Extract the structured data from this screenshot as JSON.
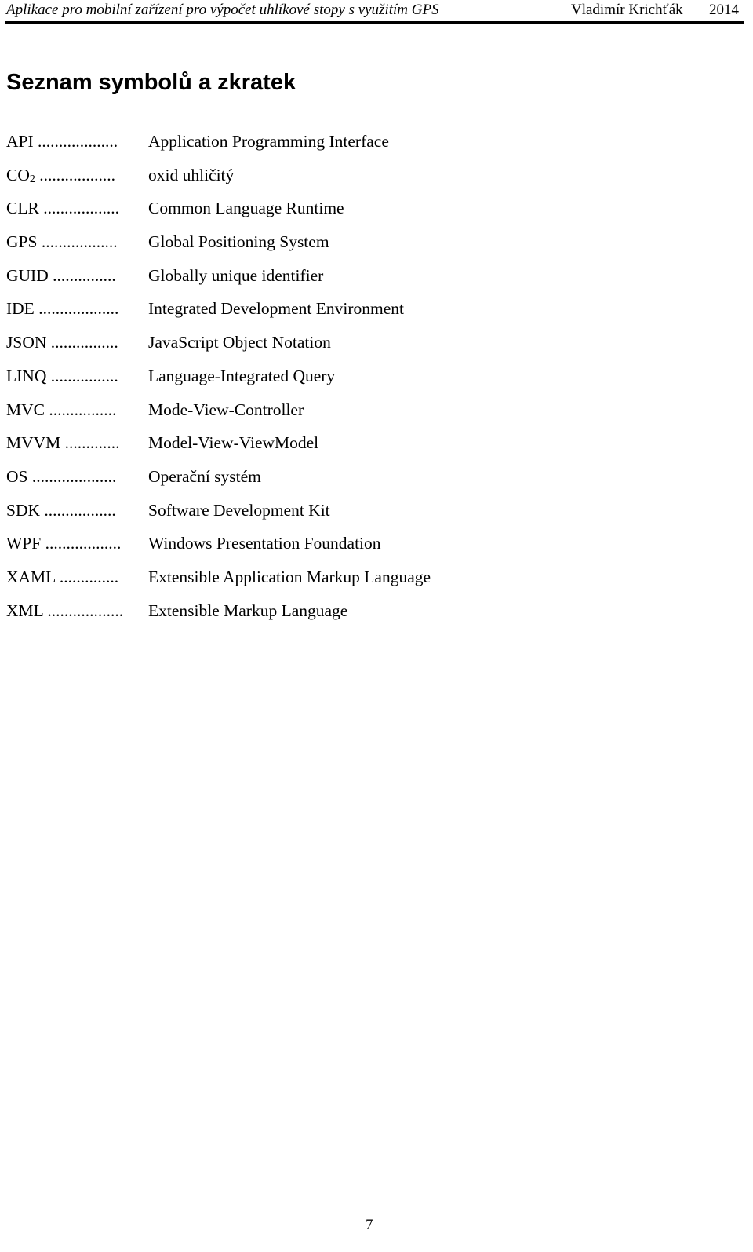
{
  "header": {
    "title": "Aplikace pro mobilní zařízení pro výpočet uhlíkové stopy s využitím GPS",
    "author": "Vladimír Krichťák",
    "year": "2014"
  },
  "heading": "Seznam symbolů a zkratek",
  "entries": [
    {
      "abbr": "API",
      "sub": "",
      "dots": " ...................",
      "desc": "Application Programming Interface"
    },
    {
      "abbr": "CO",
      "sub": "2",
      "dots": " ..................",
      "desc": "oxid uhličitý"
    },
    {
      "abbr": "CLR",
      "sub": "",
      "dots": " ..................",
      "desc": "Common Language Runtime"
    },
    {
      "abbr": "GPS",
      "sub": "",
      "dots": " ..................",
      "desc": "Global Positioning System"
    },
    {
      "abbr": "GUID",
      "sub": "",
      "dots": " ...............",
      "desc": "Globally unique identifier"
    },
    {
      "abbr": "IDE",
      "sub": "",
      "dots": " ...................",
      "desc": "Integrated Development Environment"
    },
    {
      "abbr": "JSON",
      "sub": "",
      "dots": " ................",
      "desc": "JavaScript Object Notation"
    },
    {
      "abbr": "LINQ",
      "sub": "",
      "dots": " ................",
      "desc": "Language-Integrated Query"
    },
    {
      "abbr": "MVC",
      "sub": "",
      "dots": " ................",
      "desc": "Mode-View-Controller"
    },
    {
      "abbr": "MVVM",
      "sub": "",
      "dots": " .............",
      "desc": "Model-View-ViewModel"
    },
    {
      "abbr": "OS",
      "sub": "",
      "dots": " ....................",
      "desc": "Operační systém"
    },
    {
      "abbr": "SDK",
      "sub": "",
      "dots": " .................",
      "desc": "Software Development Kit"
    },
    {
      "abbr": "WPF",
      "sub": "",
      "dots": " ..................",
      "desc": "Windows Presentation Foundation"
    },
    {
      "abbr": "XAML",
      "sub": "",
      "dots": " ..............",
      "desc": "Extensible Application Markup Language"
    },
    {
      "abbr": "XML",
      "sub": "",
      "dots": " ..................",
      "desc": "Extensible Markup Language"
    }
  ],
  "page_number": "7"
}
